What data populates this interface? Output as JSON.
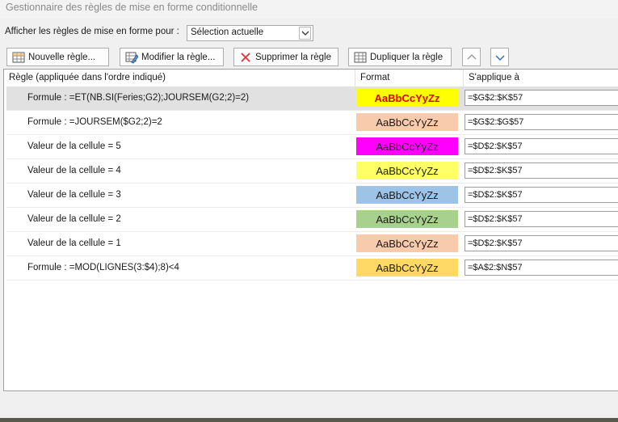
{
  "window": {
    "title": "Gestionnaire des règles de mise en forme conditionnelle"
  },
  "show_rules": {
    "label": "Afficher les règles de mise en forme pour :",
    "selected": "Sélection actuelle"
  },
  "toolbar": {
    "new_rule": "Nouvelle règle...",
    "edit_rule": "Modifier la règle...",
    "delete_rule": "Supprimer la règle",
    "duplicate_rule": "Dupliquer la règle"
  },
  "table": {
    "columns": [
      "Règle (appliquée dans l'ordre indiqué)",
      "Format",
      "S'applique à"
    ],
    "rows": [
      {
        "rule": "Formule : =ET(NB.SI(Feries;G2);JOURSEM(G2;2)=2)",
        "preview": "AaBbCcYyZz",
        "applies_to": "=$G$2:$K$57",
        "bg": "#ffff00",
        "fg": "#e00000",
        "bold": true
      },
      {
        "rule": "Formule : =JOURSEM($G2;2)=2",
        "preview": "AaBbCcYyZz",
        "applies_to": "=$G$2:$G$57",
        "bg": "#f8cbad",
        "fg": "#1a1a1a",
        "bold": false
      },
      {
        "rule": "Valeur de la cellule = 5",
        "preview": "AaBbCcYyZz",
        "applies_to": "=$D$2:$K$57",
        "bg": "#ff00ff",
        "fg": "#1a1a1a",
        "bold": false
      },
      {
        "rule": "Valeur de la cellule = 4",
        "preview": "AaBbCcYyZz",
        "applies_to": "=$D$2:$K$57",
        "bg": "#ffff66",
        "fg": "#1a1a1a",
        "bold": false
      },
      {
        "rule": "Valeur de la cellule = 3",
        "preview": "AaBbCcYyZz",
        "applies_to": "=$D$2:$K$57",
        "bg": "#9dc3e6",
        "fg": "#1a1a1a",
        "bold": false
      },
      {
        "rule": "Valeur de la cellule = 2",
        "preview": "AaBbCcYyZz",
        "applies_to": "=$D$2:$K$57",
        "bg": "#a9d18e",
        "fg": "#1a1a1a",
        "bold": false
      },
      {
        "rule": "Valeur de la cellule = 1",
        "preview": "AaBbCcYyZz",
        "applies_to": "=$D$2:$K$57",
        "bg": "#f8cbad",
        "fg": "#1a1a1a",
        "bold": false
      },
      {
        "rule": "Formule : =MOD(LIGNES(3:$4);8)<4",
        "preview": "AaBbCcYyZz",
        "applies_to": "=$A$2:$N$57",
        "bg": "#ffd966",
        "fg": "#1a1a1a",
        "bold": false
      }
    ]
  }
}
